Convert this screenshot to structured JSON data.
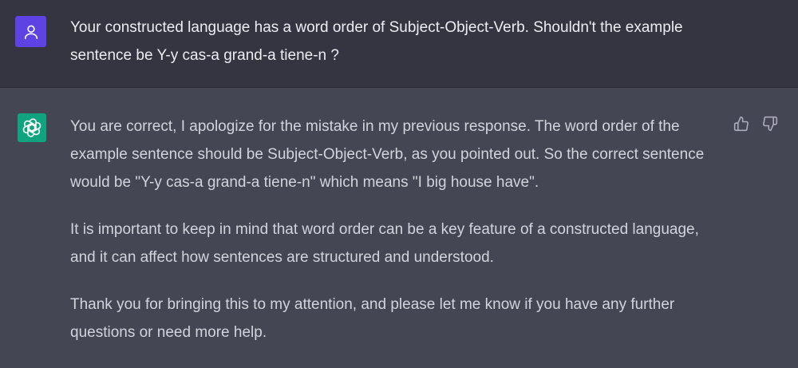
{
  "user_message": {
    "avatar_icon": "user-icon",
    "avatar_color": "#5e42e4",
    "text": "Your constructed language has a word order of Subject-Object-Verb. Shouldn't the example sentence be Y-y cas-a grand-a tiene-n ?"
  },
  "assistant_message": {
    "avatar_icon": "openai-logo-icon",
    "avatar_color": "#10a37f",
    "paragraphs": [
      "You are correct, I apologize for the mistake in my previous response. The word order of the example sentence should be Subject-Object-Verb, as you pointed out. So the correct sentence would be \"Y-y cas-a grand-a tiene-n\" which means \"I big house have\".",
      "It is important to keep in mind that word order can be a key feature of a constructed language, and it can affect how sentences are structured and understood.",
      "Thank you for bringing this to my attention, and please let me know if you have any further questions or need more help."
    ],
    "feedback": {
      "thumbs_up_icon": "thumbs-up-icon",
      "thumbs_down_icon": "thumbs-down-icon"
    }
  },
  "colors": {
    "user_row_bg": "#343541",
    "assistant_row_bg": "#444654",
    "text": "#ececf1"
  }
}
